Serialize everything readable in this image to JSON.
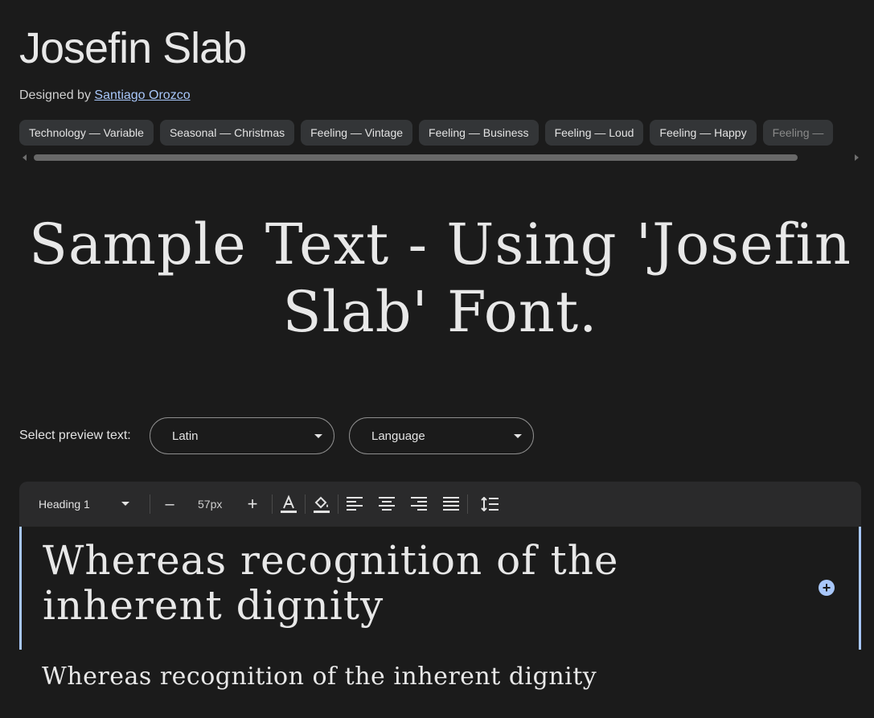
{
  "font": {
    "name": "Josefin Slab",
    "designed_by_label": "Designed by",
    "designer": "Santiago Orozco"
  },
  "tags": [
    "Technology — Variable",
    "Seasonal — Christmas",
    "Feeling — Vintage",
    "Feeling — Business",
    "Feeling — Loud",
    "Feeling — Happy",
    "Feeling —"
  ],
  "sample_text": "Sample Text - Using 'Josefin Slab' Font.",
  "preview": {
    "label": "Select preview text:",
    "script_value": "Latin",
    "language_value": "Language"
  },
  "toolbar": {
    "style_value": "Heading 1",
    "font_size": "57px",
    "decrease": "–",
    "increase": "+"
  },
  "editor": {
    "heading_text": "Whereas recognition of the inherent dignity",
    "paragraph_text": "Whereas recognition of the inherent dignity"
  },
  "colors": {
    "background": "#1b1b1b",
    "accent": "#a8c7fa",
    "chip_bg": "#333537",
    "toolbar_bg": "#2a2a2b"
  }
}
